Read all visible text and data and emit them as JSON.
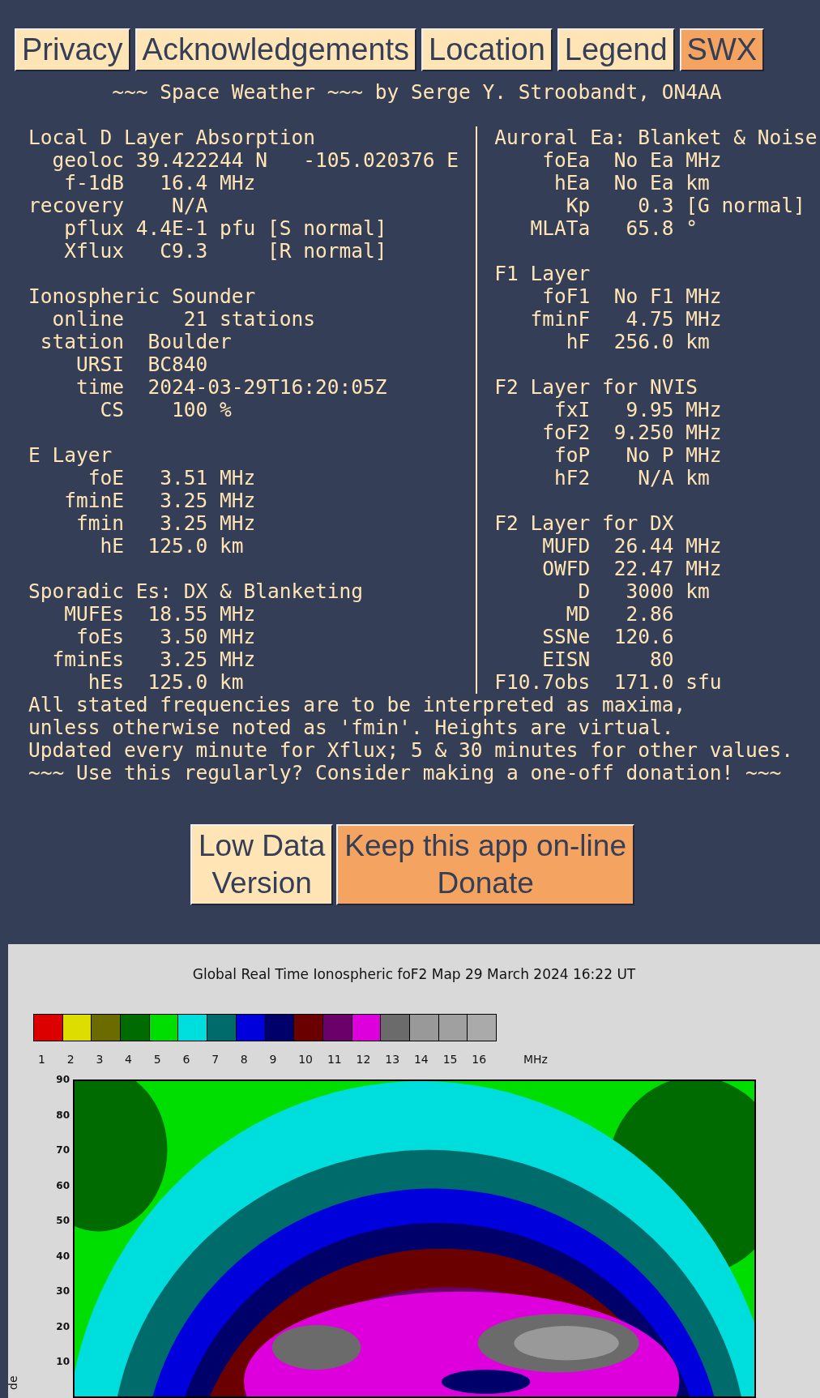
{
  "nav": [
    {
      "label": "Privacy",
      "selected": false
    },
    {
      "label": "Acknowledgements",
      "selected": false
    },
    {
      "label": "Location",
      "selected": false
    },
    {
      "label": "Legend",
      "selected": false
    },
    {
      "label": "SWX",
      "selected": true
    }
  ],
  "report": {
    "heading": "       ~~~ Space Weather ~~~ by Serge Y. Stroobandt, ON4AA",
    "rows": [
      {
        "left": "Local D Layer Absorption",
        "right": "Auroral Ea: Blanket & Noise"
      },
      {
        "left": "  geoloc 39.422244 N   -105.020376 E",
        "right": "    foEa  No Ea MHz"
      },
      {
        "left": "   f-1dB   16.4 MHz",
        "right": "     hEa  No Ea km"
      },
      {
        "left": "recovery    N/A",
        "right": "      Kp    0.3 [G normal]"
      },
      {
        "left": "   pflux 4.4E-1 pfu [S normal]",
        "right": "   MLATa   65.8 °"
      },
      {
        "left": "   Xflux   C9.3     [R normal]"
      },
      {
        "right": "F1 Layer"
      },
      {
        "left": "Ionospheric Sounder",
        "right": "    foF1  No F1 MHz"
      },
      {
        "left": "  online     21 stations",
        "right": "   fminF   4.75 MHz"
      },
      {
        "left": " station  Boulder",
        "right": "      hF  256.0 km"
      },
      {
        "left": "    URSI  BC840"
      },
      {
        "left": "    time  2024-03-29T16:20:05Z",
        "right": "F2 Layer for NVIS"
      },
      {
        "left": "      CS    100 %",
        "right": "     fxI   9.95 MHz"
      },
      {
        "right": "    foF2  9.250 MHz"
      },
      {
        "left": "E Layer",
        "right": "     foP   No P MHz"
      },
      {
        "left": "     foE   3.51 MHz",
        "right": "     hF2    N/A km"
      },
      {
        "left": "   fminE   3.25 MHz"
      },
      {
        "left": "    fmin   3.25 MHz",
        "right": "F2 Layer for DX"
      },
      {
        "left": "      hE  125.0 km",
        "right": "    MUFD  26.44 MHz"
      },
      {
        "right": "    OWFD  22.47 MHz"
      },
      {
        "left": "Sporadic Es: DX & Blanketing",
        "right": "       D   3000 km"
      },
      {
        "left": "   MUFEs  18.55 MHz",
        "right": "      MD   2.86"
      },
      {
        "left": "    foEs   3.50 MHz",
        "right": "    SSNe  120.6"
      },
      {
        "left": "  fminEs   3.25 MHz",
        "right": "    EISN     80"
      },
      {
        "left": "     hEs  125.0 km",
        "right": "F10.7obs  171.0 sfu"
      }
    ],
    "notes": [
      "All stated frequencies are to be interpreted as maxima,",
      "unless otherwise noted as 'fmin'. Heights are virtual.",
      "Updated every minute for Xflux; 5 & 30 minutes for other values.",
      "~~~ Use this regularly? Consider making a one-off donation! ~~~"
    ]
  },
  "actions": [
    {
      "label": "Low Data\nVersion",
      "highlight": false
    },
    {
      "label": "Keep this app on-line\nDonate",
      "highlight": true
    }
  ],
  "map": {
    "title": "Global Real Time Ionospheric foF2 Map  29 March 2024 16:22 UT",
    "legend": [
      {
        "label": "1",
        "color": "#dd0000"
      },
      {
        "label": "2",
        "color": "#dddd00"
      },
      {
        "label": "3",
        "color": "#6b6b00"
      },
      {
        "label": "4",
        "color": "#006b00"
      },
      {
        "label": "5",
        "color": "#00dd00"
      },
      {
        "label": "6",
        "color": "#00dddd"
      },
      {
        "label": "7",
        "color": "#006b6b"
      },
      {
        "label": "8",
        "color": "#0000dd"
      },
      {
        "label": "9",
        "color": "#00006b"
      },
      {
        "label": "10",
        "color": "#6b0000"
      },
      {
        "label": "11",
        "color": "#6b006b"
      },
      {
        "label": "12",
        "color": "#dd00dd"
      },
      {
        "label": "13",
        "color": "#6b6b6b"
      },
      {
        "label": "14",
        "color": "#999999"
      },
      {
        "label": "15",
        "color": "#a0a0a0"
      },
      {
        "label": "16",
        "color": "#aaaaaa"
      }
    ],
    "unit": "MHz",
    "y_ticks": [
      "90",
      "80",
      "70",
      "60",
      "50",
      "40",
      "30",
      "20",
      "10"
    ],
    "y_label": "de"
  }
}
